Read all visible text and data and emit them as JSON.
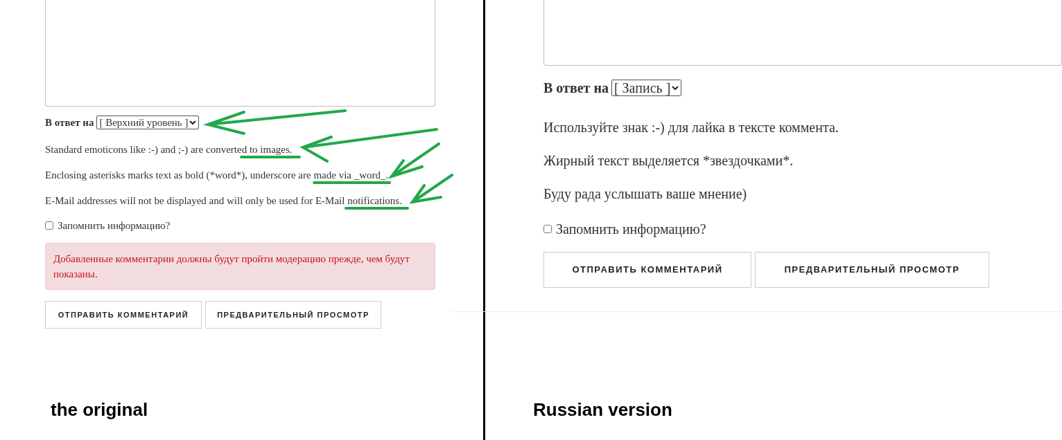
{
  "panels": [
    {
      "reply_label": "В ответ на",
      "reply_select": "[ Верхний уровень ]",
      "notes": [
        "Standard emoticons like :-) and ;-) are converted to images.",
        "Enclosing asterisks marks text as bold (*word*), underscore are made via _word_.",
        "E-Mail addresses will not be displayed and will only be used for E-Mail notifications."
      ],
      "remember": {
        "label": "Запомнить информацию?",
        "checked": false
      },
      "moderation_notice": "Добавленные комментарии должны будут пройти модерацию прежде, чем будут показаны.",
      "buttons": [
        "ОТПРАВИТЬ КОММЕНТАРИЙ",
        "ПРЕДВАРИТЕЛЬНЫЙ ПРОСМОТР"
      ],
      "caption": "the original"
    },
    {
      "reply_label": "В ответ на",
      "reply_select": "[ Запись ]",
      "notes": [
        "Используйте знак :-) для лайка в тексте коммента.",
        "Жирный текст выделяется *звездочками*.",
        "Буду рада услышать ваше мнение)"
      ],
      "remember": {
        "label": "Запомнить информацию?",
        "checked": false
      },
      "buttons": [
        "ОТПРАВИТЬ КОММЕНТАРИЙ",
        "ПРЕДВАРИТЕЛЬНЫЙ ПРОСМОТР"
      ],
      "caption": "Russian version"
    }
  ]
}
